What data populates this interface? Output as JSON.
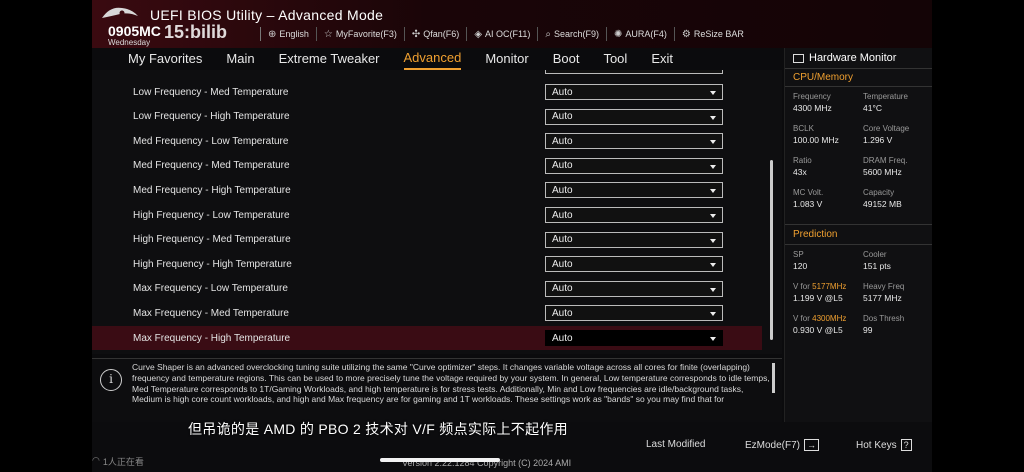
{
  "header": {
    "title": "UEFI BIOS Utility – Advanced Mode",
    "date": "0905MC",
    "day": "Wednesday",
    "watermark": "15:bilib",
    "toolbar": [
      {
        "icon": "globe-icon",
        "label": "English"
      },
      {
        "icon": "star-icon",
        "label": "MyFavorite(F3)"
      },
      {
        "icon": "fan-icon",
        "label": "Qfan(F6)"
      },
      {
        "icon": "ai-icon",
        "label": "AI OC(F11)"
      },
      {
        "icon": "search-icon",
        "label": "Search(F9)"
      },
      {
        "icon": "aura-icon",
        "label": "AURA(F4)"
      },
      {
        "icon": "resize-icon",
        "label": "ReSize BAR"
      }
    ]
  },
  "menu": [
    "My Favorites",
    "Main",
    "Extreme Tweaker",
    "Advanced",
    "Monitor",
    "Boot",
    "Tool",
    "Exit"
  ],
  "menu_active": "Advanced",
  "settings": [
    {
      "label": "Low Frequency - Med Temperature",
      "value": "Auto"
    },
    {
      "label": "Low Frequency - High Temperature",
      "value": "Auto"
    },
    {
      "label": "Med Frequency - Low Temperature",
      "value": "Auto"
    },
    {
      "label": "Med Frequency - Med Temperature",
      "value": "Auto"
    },
    {
      "label": "Med Frequency - High Temperature",
      "value": "Auto"
    },
    {
      "label": "High Frequency - Low Temperature",
      "value": "Auto"
    },
    {
      "label": "High Frequency - Med Temperature",
      "value": "Auto"
    },
    {
      "label": "High Frequency - High Temperature",
      "value": "Auto"
    },
    {
      "label": "Max Frequency - Low Temperature",
      "value": "Auto"
    },
    {
      "label": "Max Frequency - Med Temperature",
      "value": "Auto"
    },
    {
      "label": "Max Frequency - High Temperature",
      "value": "Auto",
      "selected": true
    }
  ],
  "info": {
    "text": "Curve Shaper is an advanced overclocking tuning suite utilizing the same \"Curve optimizer\" steps. It changes variable voltage across all cores for finite (overlapping) frequency and temperature regions. This can be used to more precisely tune the voltage required by your system. In general, Low temperature corresponds to idle temps, Med Temperature corresponds to 1T/Gaming Workloads, and high temperature is for stress tests. Additionally, Min and Low frequencies are idle/background tasks, Medium is high core count workloads, and high and Max frequency are for gaming and 1T workloads. These settings work as \"bands\" so you may find that for"
  },
  "hardware_monitor": {
    "title": "Hardware Monitor",
    "cpu_memory": {
      "title": "CPU/Memory",
      "items": [
        {
          "label": "Frequency",
          "value": "4300 MHz"
        },
        {
          "label": "Temperature",
          "value": "41°C"
        },
        {
          "label": "BCLK",
          "value": "100.00 MHz"
        },
        {
          "label": "Core Voltage",
          "value": "1.296 V"
        },
        {
          "label": "Ratio",
          "value": "43x"
        },
        {
          "label": "DRAM Freq.",
          "value": "5600 MHz"
        },
        {
          "label": "MC Volt.",
          "value": "1.083 V"
        },
        {
          "label": "Capacity",
          "value": "49152 MB"
        }
      ]
    },
    "prediction": {
      "title": "Prediction",
      "sp_label": "SP",
      "sp_value": "120",
      "cooler_label": "Cooler",
      "cooler_value": "151 pts",
      "vfor1_prefix": "V for ",
      "vfor1_freq": "5177MHz",
      "vfor1_value": "1.199 V @L5",
      "heavy_label": "Heavy Freq",
      "heavy_value": "5177 MHz",
      "vfor2_prefix": "V for ",
      "vfor2_freq": "4300MHz",
      "vfor2_value": "0.930 V @L5",
      "dos_label": "Dos Thresh",
      "dos_value": "99"
    }
  },
  "footer": {
    "subtitle": "但吊诡的是 AMD 的 PBO 2 技术对 V/F 频点实际上不起作用",
    "last_modified": "Last Modified",
    "ezmode": "EzMode(F7)",
    "ezmode_key": "→",
    "hotkeys": "Hot Keys",
    "hotkeys_key": "?",
    "version": "Version 2.22.1284 Copyright (C) 2024 AMI",
    "viewers": "1人正在看"
  },
  "colors": {
    "accent": "#f0a030",
    "selected_row": "#3a0c14",
    "header_red": "#3a0a10"
  }
}
